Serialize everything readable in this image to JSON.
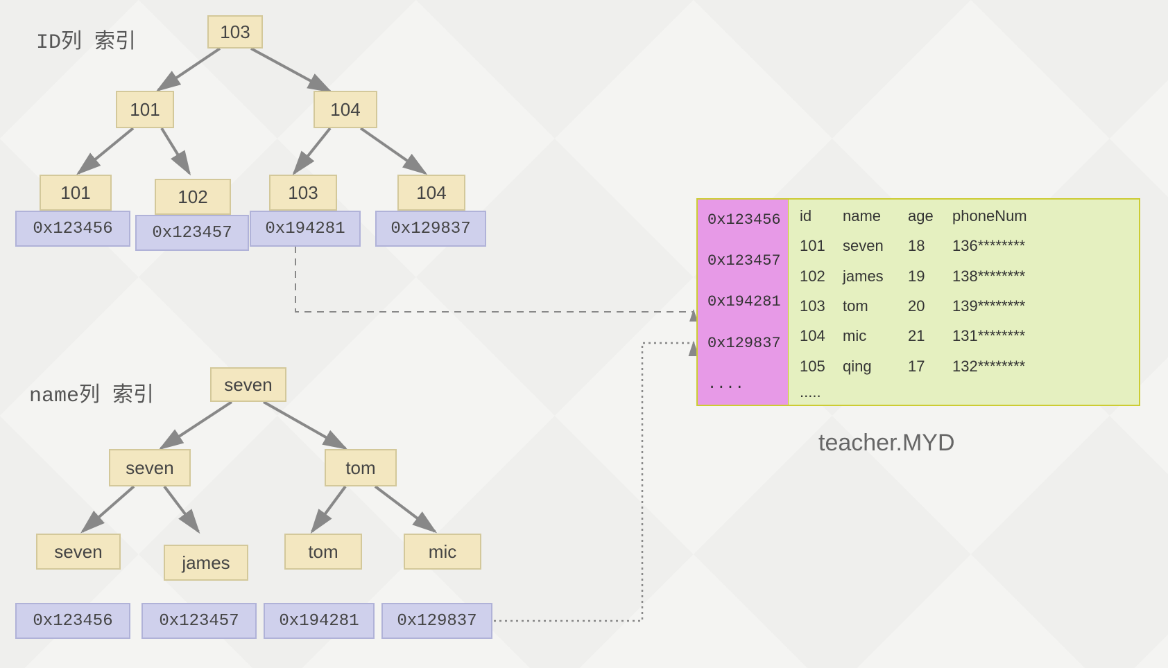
{
  "labels": {
    "id_index": "ID列 索引",
    "name_index": "name列 索引"
  },
  "id_tree": {
    "root": "103",
    "l": "101",
    "r": "104",
    "leaves": [
      {
        "key": "101",
        "addr": "0x123456"
      },
      {
        "key": "102",
        "addr": "0x123457"
      },
      {
        "key": "103",
        "addr": "0x194281"
      },
      {
        "key": "104",
        "addr": "0x129837"
      }
    ]
  },
  "name_tree": {
    "root": "seven",
    "l": "seven",
    "r": "tom",
    "leaves": [
      {
        "key": "seven",
        "addr": "0x123456"
      },
      {
        "key": "james",
        "addr": "0x123457"
      },
      {
        "key": "tom",
        "addr": "0x194281"
      },
      {
        "key": "mic",
        "addr": "0x129837"
      }
    ]
  },
  "table": {
    "caption": "teacher.MYD",
    "addr_col": [
      "0x123456",
      "0x123457",
      "0x194281",
      "0x129837",
      "...."
    ],
    "header": {
      "id": "id",
      "name": "name",
      "age": "age",
      "phone": "phoneNum"
    },
    "rows": [
      {
        "id": "101",
        "name": "seven",
        "age": "18",
        "phone": "136********"
      },
      {
        "id": "102",
        "name": "james",
        "age": "19",
        "phone": "138********"
      },
      {
        "id": "103",
        "name": "tom",
        "age": "20",
        "phone": "139********"
      },
      {
        "id": "104",
        "name": "mic",
        "age": "21",
        "phone": "131********"
      },
      {
        "id": "105",
        "name": "qing",
        "age": "17",
        "phone": "132********"
      }
    ],
    "trailing": "....."
  }
}
